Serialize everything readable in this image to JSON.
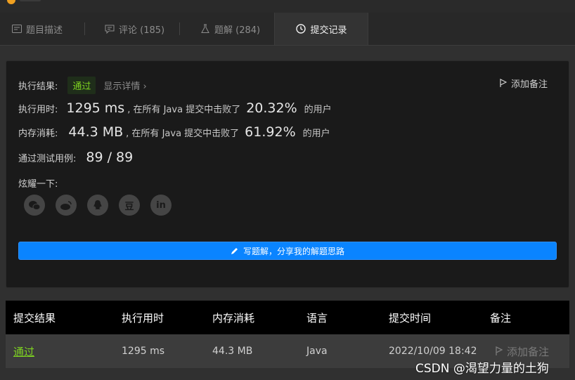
{
  "tabs": [
    {
      "label": "题目描述",
      "icon": "description-icon"
    },
    {
      "label": "评论 (185)",
      "icon": "comment-icon"
    },
    {
      "label": "题解 (284)",
      "icon": "flask-icon"
    },
    {
      "label": "提交记录",
      "icon": "clock-icon"
    }
  ],
  "result": {
    "label": "执行结果:",
    "status": "通过",
    "details": "显示详情 ›",
    "add_note": "添加备注",
    "runtime_label": "执行用时:",
    "runtime_value": "1295 ms",
    "runtime_text": ", 在所有 Java 提交中击败了",
    "runtime_pct": "20.32%",
    "runtime_suffix": "的用户",
    "memory_label": "内存消耗:",
    "memory_value": "44.3 MB",
    "memory_text": ", 在所有 Java 提交中击败了",
    "memory_pct": "61.92%",
    "memory_suffix": "的用户",
    "tests_label": "通过测试用例:",
    "tests_value": "89 / 89",
    "share_label": "炫耀一下:",
    "share_icons": [
      "wechat-icon",
      "weibo-icon",
      "qq-icon",
      "douban-icon",
      "linkedin-icon"
    ],
    "share_glyphs": [
      "",
      "",
      "",
      "豆",
      "in"
    ],
    "write_button": "写题解，分享我的解题思路"
  },
  "table": {
    "headers": [
      "提交结果",
      "执行用时",
      "内存消耗",
      "语言",
      "提交时间",
      "备注"
    ],
    "row": {
      "status": "通过",
      "runtime": "1295 ms",
      "memory": "44.3 MB",
      "language": "Java",
      "time": "2022/10/09 18:42",
      "note": "添加备注"
    }
  },
  "watermark": "CSDN @渴望力量的土狗",
  "colors": {
    "accent": "#0a84ff",
    "success": "#7ed321"
  }
}
